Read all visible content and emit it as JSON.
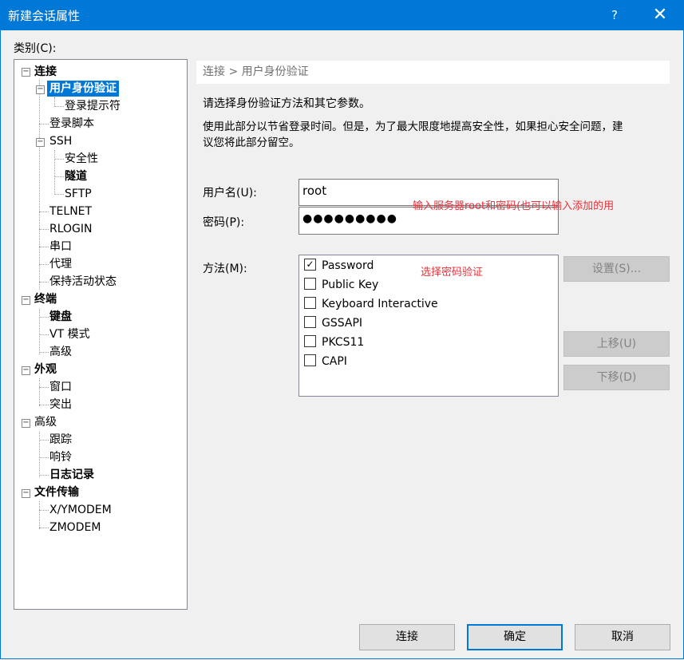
{
  "window": {
    "title": "新建会话属性",
    "help_label": "?",
    "close_label": "✕"
  },
  "category_label": "类别(C):",
  "tree": {
    "connection": "连接",
    "user_auth": "用户身份验证",
    "login_prompts": "登录提示符",
    "login_script": "登录脚本",
    "ssh": "SSH",
    "security": "安全性",
    "tunnel": "隧道",
    "sftp": "SFTP",
    "telnet": "TELNET",
    "rlogin": "RLOGIN",
    "serial": "串口",
    "proxy": "代理",
    "keepalive": "保持活动状态",
    "terminal": "终端",
    "keyboard": "键盘",
    "vt_mode": "VT 模式",
    "advanced1": "高级",
    "appearance": "外观",
    "window": "窗口",
    "highlight": "突出",
    "advanced": "高级",
    "trace": "跟踪",
    "bell": "响铃",
    "logging": "日志记录",
    "file_transfer": "文件传输",
    "xymodem": "X/YMODEM",
    "zmodem": "ZMODEM"
  },
  "pane": {
    "breadcrumb": "连接 > 用户身份验证",
    "desc1": "请选择身份验证方法和其它参数。",
    "desc2_line1": "使用此部分以节省登录时间。但是，为了最大限度地提高安全性，如果担心安全问题，建",
    "desc2_line2": "议您将此部分留空。",
    "username_label": "用户名(U):",
    "username_value": "root",
    "password_label": "密码(P):",
    "password_value": "●●●●●●●●●",
    "method_label": "方法(M):",
    "methods": [
      {
        "label": "Password",
        "checked": true
      },
      {
        "label": "Public Key",
        "checked": false
      },
      {
        "label": "Keyboard Interactive",
        "checked": false
      },
      {
        "label": "GSSAPI",
        "checked": false
      },
      {
        "label": "PKCS11",
        "checked": false
      },
      {
        "label": "CAPI",
        "checked": false
      }
    ],
    "settings_button": "设置(S)...",
    "move_up_button": "上移(U)",
    "move_down_button": "下移(D)"
  },
  "annotations": {
    "user_pass": "输入服务器root和密码(也可以输入添加的用",
    "method": "选择密码验证"
  },
  "footer": {
    "connect": "连接",
    "ok": "确定",
    "cancel": "取消"
  },
  "colors": {
    "titlebar": "#0078d7",
    "selection": "#0078d7",
    "annotation": "#e8313a"
  }
}
